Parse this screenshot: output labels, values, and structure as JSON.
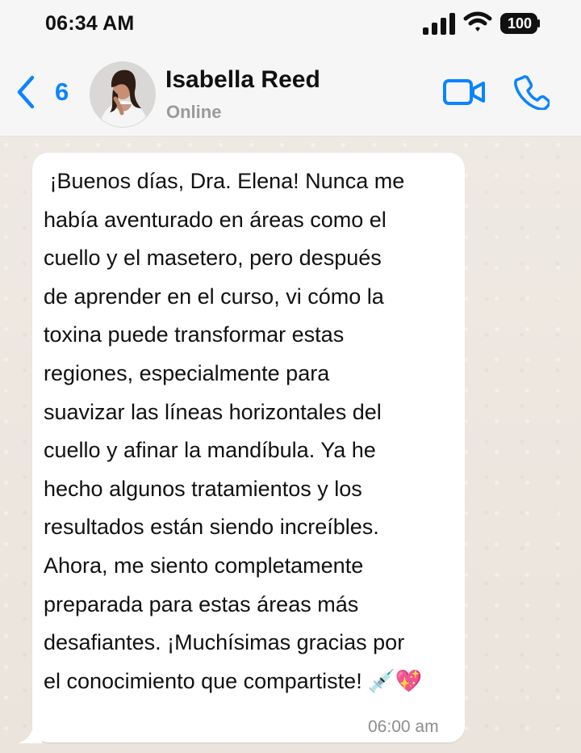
{
  "status_bar": {
    "time": "06:34 AM",
    "battery": "100"
  },
  "header": {
    "back_count": "6",
    "contact_name": "Isabella Reed",
    "contact_status": "Online"
  },
  "message": {
    "text": " ¡Buenos días, Dra. Elena! Nunca me\nhabía aventurado en áreas como el\ncuello y el masetero, pero después\nde aprender en el curso, vi cómo la\ntoxina puede transformar estas\nregiones, especialmente para\nsuavizar las líneas horizontales del\ncuello y afinar la mandíbula. Ya he\nhecho algunos tratamientos y los\nresultados están siendo increíbles.\nAhora, me siento completamente\npreparada para estas áreas más\ndesafiantes. ¡Muchísimas gracias por\nel conocimiento que compartiste! 💉💖",
    "time": "06:00 am"
  },
  "colors": {
    "accent": "#0a84ff",
    "header_bg": "#f6f6f6",
    "chat_bg": "#ece5dd",
    "bubble_bg": "#ffffff",
    "muted_text": "#8d8d8d"
  },
  "icons": {
    "back": "chevron-left-icon",
    "video": "video-camera-icon",
    "call": "phone-icon",
    "signal": "cellular-signal-icon",
    "wifi": "wifi-icon",
    "battery": "battery-icon"
  }
}
